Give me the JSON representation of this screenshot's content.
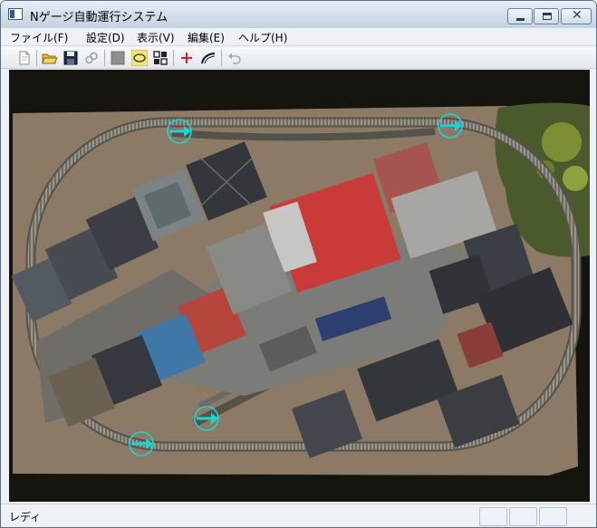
{
  "window": {
    "title": "Nゲージ自動運行システム"
  },
  "menu": {
    "items": [
      {
        "label": "ファイル(F)"
      },
      {
        "label": "設定(D)"
      },
      {
        "label": "表示(V)"
      },
      {
        "label": "編集(E)"
      },
      {
        "label": "ヘルプ(H)"
      }
    ]
  },
  "toolbar": {
    "buttons": [
      {
        "icon": "new-document-icon"
      },
      {
        "icon": "open-folder-icon"
      },
      {
        "icon": "save-disk-icon"
      },
      {
        "icon": "link-icon"
      },
      {
        "icon": "gray-block-icon"
      },
      {
        "icon": "oval-track-icon"
      },
      {
        "icon": "switch-pattern-icon"
      },
      {
        "icon": "red-cross-icon"
      },
      {
        "icon": "curve-track-icon"
      },
      {
        "icon": "undo-icon"
      }
    ]
  },
  "layout": {
    "sensor_markers": [
      {
        "name": "sensor-top-left"
      },
      {
        "name": "sensor-top-right"
      },
      {
        "name": "sensor-bottom-mid"
      },
      {
        "name": "sensor-bottom-left"
      }
    ]
  },
  "statusbar": {
    "text": "レディ"
  }
}
